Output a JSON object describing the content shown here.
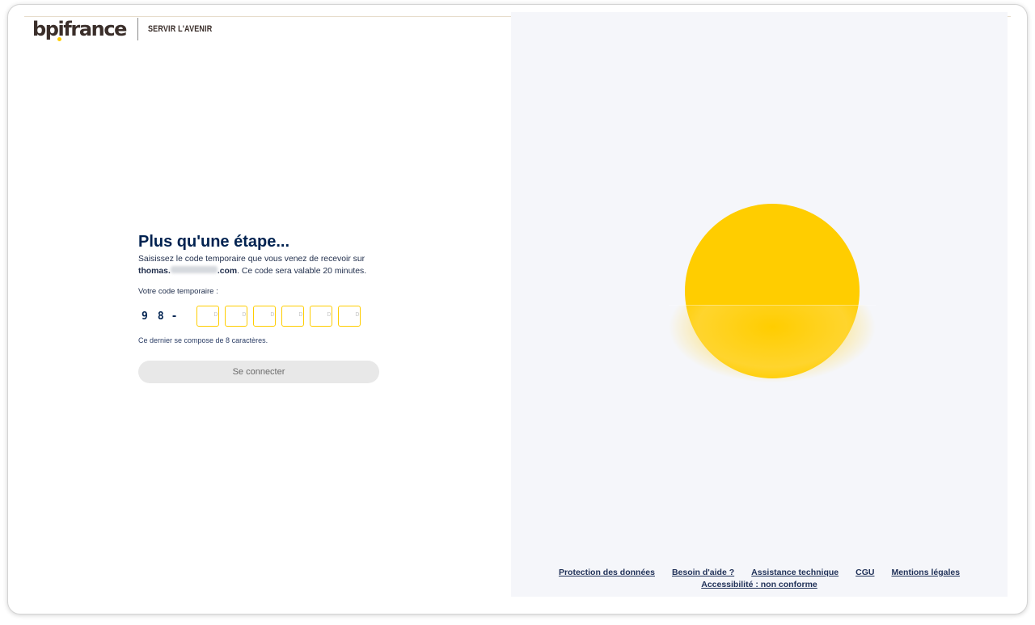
{
  "brand": {
    "logo_text": "bpifrance",
    "tagline": "SERVIR L'AVENIR",
    "accent_color": "#ffcd00",
    "primary_color": "#002250"
  },
  "form": {
    "title": "Plus qu'une étape...",
    "desc_before": "Saisissez le code temporaire que vous venez de recevoir sur",
    "email_start": "thomas.",
    "email_end": ".com",
    "desc_after": ". Ce code sera valable 20 minutes.",
    "code_label": "Votre code temporaire :",
    "code_prefix": [
      "9",
      "8"
    ],
    "code_separator": "-",
    "code_placeholder": "D",
    "hint": "Ce dernier se compose de 8 caractères.",
    "submit_label": "Se connecter"
  },
  "footer": {
    "links": [
      "Protection des données",
      "Besoin d'aide ?",
      "Assistance technique",
      "CGU",
      "Mentions légales"
    ],
    "accessibility": "Accessibilité : non conforme"
  }
}
